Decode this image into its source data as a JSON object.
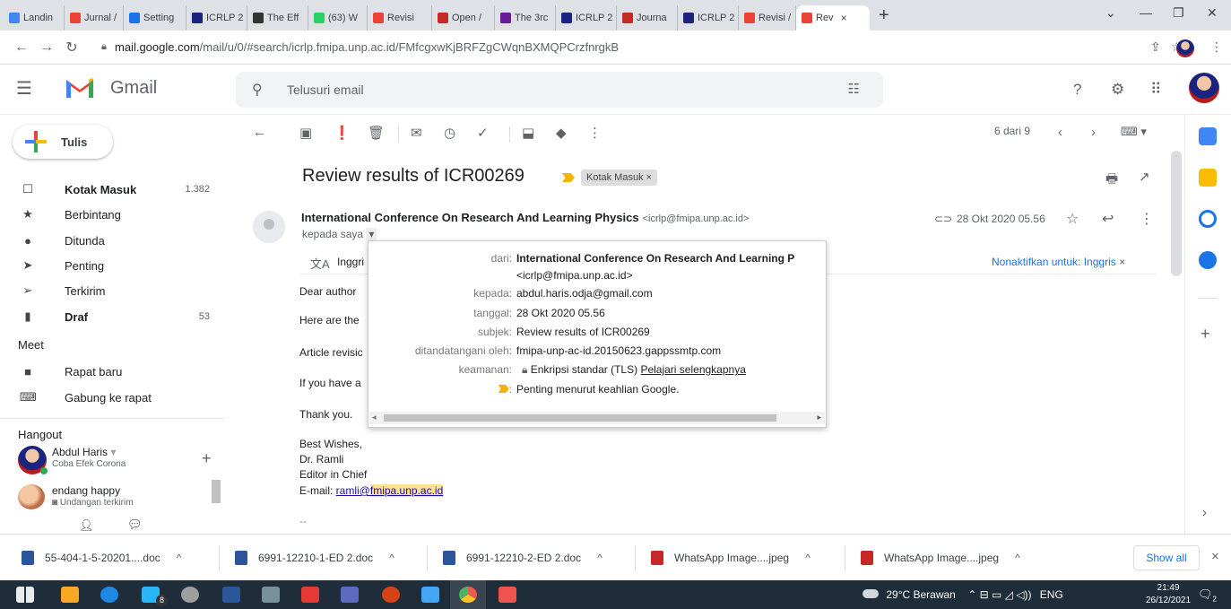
{
  "browser": {
    "tabs": [
      {
        "label": "Landin",
        "color": "#4285f4"
      },
      {
        "label": "Jurnal /",
        "color": "#ea4335"
      },
      {
        "label": "Setting",
        "color": "#1a73e8"
      },
      {
        "label": "ICRLP 2",
        "color": "#1a237e"
      },
      {
        "label": "The Eff",
        "color": "#333333"
      },
      {
        "label": "(63) W",
        "color": "#25d366"
      },
      {
        "label": "Revisi",
        "color": "#ea4335"
      },
      {
        "label": "Open /",
        "color": "#c62828"
      },
      {
        "label": "The 3rc",
        "color": "#6a1b9a"
      },
      {
        "label": "ICRLP 2",
        "color": "#1a237e"
      },
      {
        "label": "Journa",
        "color": "#c62828"
      },
      {
        "label": "ICRLP 2",
        "color": "#1a237e"
      },
      {
        "label": "Revisi /",
        "color": "#ea4335"
      }
    ],
    "active_tab": {
      "label": "Rev",
      "close": "×"
    },
    "new_tab": "+",
    "url_host": "mail.google.com",
    "url_path": "/mail/u/0/#search/icrlp.fmipa.unp.ac.id/FMfcgxwKjBRFZgCWqnBXMQPCrzfnrgkB"
  },
  "gmail": {
    "logo_text": "Gmail",
    "search_placeholder": "Telusuri email",
    "compose_label": "Tulis",
    "nav": [
      {
        "label": "Kotak Masuk",
        "count": "1.382",
        "icon": "inbox-icon",
        "glyph": "☐",
        "bold": true
      },
      {
        "label": "Berbintang",
        "count": "",
        "icon": "star-icon",
        "glyph": "★",
        "bold": false
      },
      {
        "label": "Ditunda",
        "count": "",
        "icon": "clock-icon",
        "glyph": "●",
        "bold": false
      },
      {
        "label": "Penting",
        "count": "",
        "icon": "important-icon",
        "glyph": "➤",
        "bold": false
      },
      {
        "label": "Terkirim",
        "count": "",
        "icon": "send-icon",
        "glyph": "➢",
        "bold": false
      },
      {
        "label": "Draf",
        "count": "53",
        "icon": "draft-icon",
        "glyph": "▮",
        "bold": true
      }
    ],
    "meet_title": "Meet",
    "meet_items": [
      {
        "label": "Rapat baru",
        "icon": "videocam-icon",
        "glyph": "■"
      },
      {
        "label": "Gabung ke rapat",
        "icon": "keyboard-icon",
        "glyph": "⌨"
      }
    ],
    "hangout_title": "Hangout",
    "hangouts": [
      {
        "name": "Abdul Haris",
        "status": "Coba Efek Corona",
        "caret": "▾",
        "add": "+"
      },
      {
        "name": "endang happy",
        "status": "Undangan terkirim"
      }
    ],
    "pager": "6 dari 9"
  },
  "message": {
    "subject": "Review results of ICR00269",
    "label": "Kotak Masuk",
    "label_close": "×",
    "sender_name": "International Conference On Research And Learning Physics",
    "sender_email": "<icrlp@fmipa.unp.ac.id>",
    "to": "kepada saya",
    "date": "28 Okt 2020 05.56",
    "translate_from": "Inggri",
    "translate_off": "Nonaktifkan untuk: Inggris",
    "body": {
      "greeting": "Dear author",
      "line1": "Here are the",
      "line2": "Article revisic",
      "line3": "If you have a",
      "thanks": "Thank you.",
      "sign1": "Best Wishes,",
      "sign2": "Dr. Ramli",
      "sign3": "Editor in Chief",
      "email_prefix": "E-mail: ",
      "email_user": "ramli@",
      "email_domain": "fmipa.unp.ac.id",
      "dashes": "--"
    }
  },
  "details": {
    "rows": [
      {
        "key": "dari:",
        "value": "International Conference On Research And Learning P",
        "value2": "<icrlp@fmipa.unp.ac.id>",
        "bold": true
      },
      {
        "key": "kepada:",
        "value": "abdul.haris.odja@gmail.com"
      },
      {
        "key": "tanggal:",
        "value": "28 Okt 2020 05.56"
      },
      {
        "key": "subjek:",
        "value": "Review results of ICR00269"
      },
      {
        "key": "ditandatangani oleh:",
        "value": "fmipa-unp-ac-id.20150623.gappssmtp.com"
      },
      {
        "key": "keamanan:",
        "value": "Enkripsi standar (TLS)",
        "link": "Pelajari selengkapnya"
      },
      {
        "key": ":",
        "value": "Penting menurut keahlian Google."
      }
    ]
  },
  "downloads": {
    "items": [
      {
        "name": "55-404-1-5-20201....doc",
        "color": "#2b579a"
      },
      {
        "name": "6991-12210-1-ED 2.doc",
        "color": "#2b579a"
      },
      {
        "name": "6991-12210-2-ED 2.doc",
        "color": "#2b579a"
      },
      {
        "name": "WhatsApp Image....jpeg",
        "color": "#c62828"
      },
      {
        "name": "WhatsApp Image....jpeg",
        "color": "#c62828"
      }
    ],
    "show_all": "Show all",
    "close": "×"
  },
  "taskbar": {
    "weather": "29°C Berawan",
    "lang": "ENG",
    "time": "21:49",
    "date": "26/12/2021",
    "badge_8": "8",
    "notif_count": "2"
  }
}
